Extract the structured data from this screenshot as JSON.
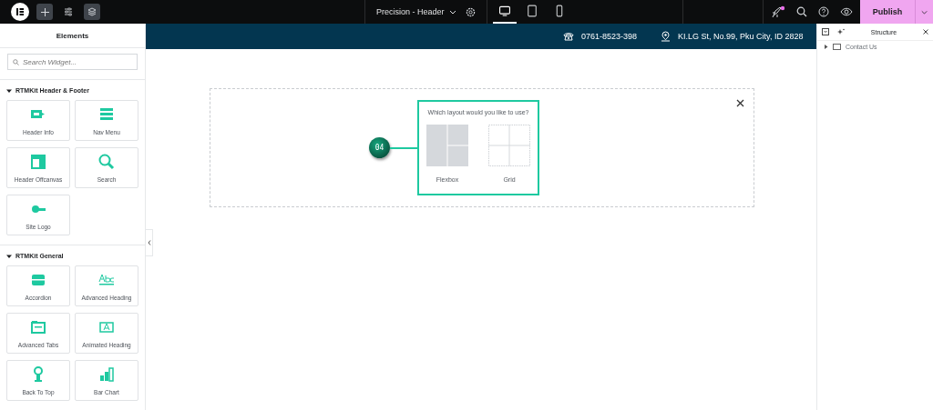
{
  "topbar": {
    "document_title": "Precision - Header",
    "devices": [
      {
        "kind": "desktop",
        "selected": true
      },
      {
        "kind": "tablet",
        "selected": false
      },
      {
        "kind": "mobile",
        "selected": false
      }
    ],
    "layers_selected": true,
    "notification": true,
    "publish": "Publish"
  },
  "panel": {
    "title": "Elements",
    "search": {
      "placeholder": "Search Widget..."
    },
    "sections": [
      {
        "title": "RTMKit Header & Footer",
        "expanded": true,
        "widgets": [
          {
            "label": "Header Info",
            "kind": "info"
          },
          {
            "label": "Nav Menu",
            "kind": "menu"
          },
          {
            "label": "Header Offcanvas",
            "kind": "offcanvas"
          },
          {
            "label": "Search",
            "kind": "search"
          },
          {
            "label": "Site Logo",
            "kind": "logo"
          }
        ]
      },
      {
        "title": "RTMKit General",
        "expanded": true,
        "widgets": [
          {
            "label": "Accordion",
            "kind": "accordion"
          },
          {
            "label": "Advanced Heading",
            "kind": "heading"
          },
          {
            "label": "Advanced Tabs",
            "kind": "tabs"
          },
          {
            "label": "Animated Heading",
            "kind": "animated"
          },
          {
            "label": "Back To Top",
            "kind": "totop"
          },
          {
            "label": "Bar Chart",
            "kind": "chart"
          }
        ]
      }
    ]
  },
  "header_strip": {
    "phone": "0761-8523-398",
    "address": "KI.LG St, No.99, Pku City, ID 2828"
  },
  "layout_picker": {
    "step": "04",
    "question": "Which layout would you like to use?",
    "options": [
      {
        "label": "Flexbox",
        "kind": "flexbox"
      },
      {
        "label": "Grid",
        "kind": "grid"
      }
    ]
  },
  "structure": {
    "title": "Structure",
    "items": [
      {
        "label": "Contact Us",
        "expanded": false
      }
    ]
  }
}
